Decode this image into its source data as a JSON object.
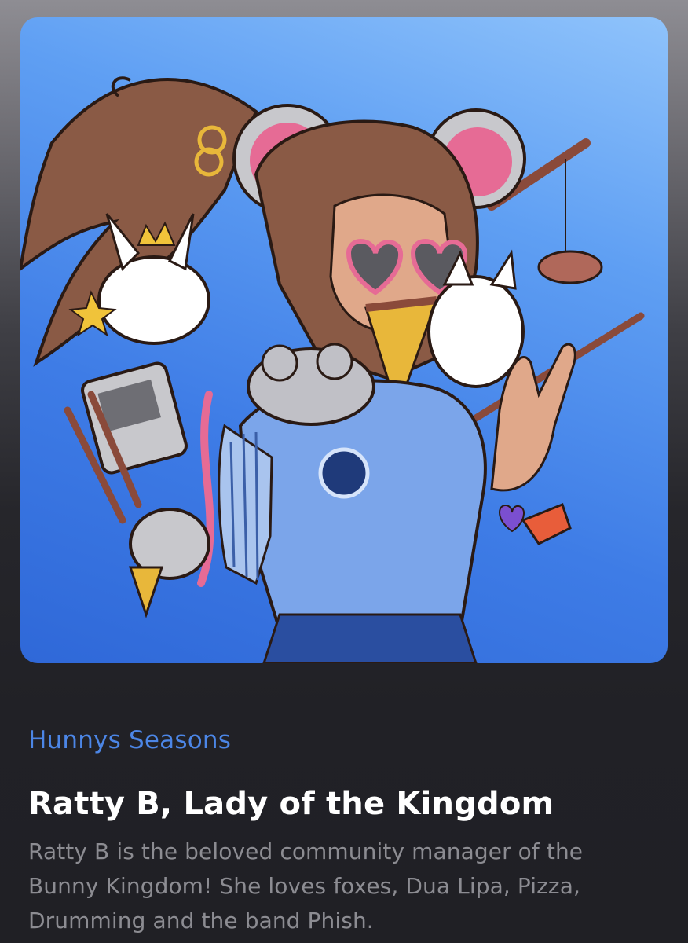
{
  "collection": {
    "name": "Hunnys Seasons"
  },
  "nft": {
    "title": "Ratty B, Lady of the Kingdom",
    "description": "Ratty B is the beloved community manager of the Bunny Kingdom! She loves foxes, Dua Lipa, Pizza, Drumming and the band Phish."
  },
  "colors": {
    "collection_accent": "#4c86e6",
    "title_text": "#ffffff",
    "description_text": "#8c8c92",
    "artwork_background": "#4a86ec"
  }
}
